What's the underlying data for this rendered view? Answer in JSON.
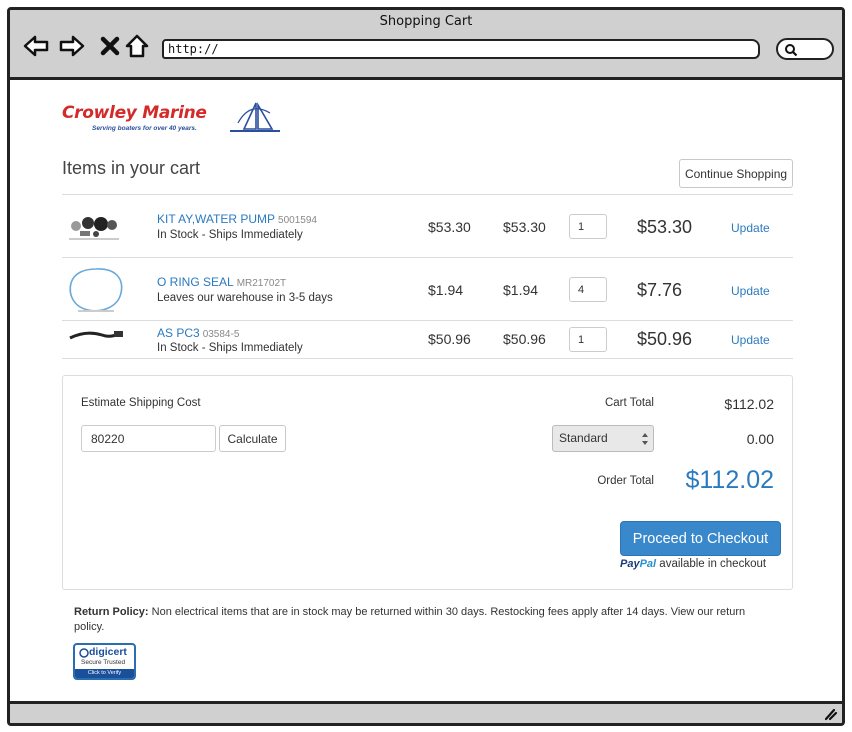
{
  "window": {
    "title": "Shopping Cart",
    "url": "http://"
  },
  "brand": {
    "name": "Crowley Marine",
    "tagline": "Serving boaters for over 40 years.",
    "color": "#d42a2a"
  },
  "page": {
    "title": "Items in your cart",
    "continue_label": "Continue Shopping"
  },
  "cart": {
    "items": [
      {
        "name": "KIT AY,WATER PUMP",
        "sku": "5001594",
        "status": "In Stock - Ships Immediately",
        "price": "$53.30",
        "sale_price": "$53.30",
        "qty": "1",
        "total": "$53.30",
        "update_label": "Update"
      },
      {
        "name": "O RING SEAL",
        "sku": "MR21702T",
        "status": "Leaves our warehouse in 3-5 days",
        "price": "$1.94",
        "sale_price": "$1.94",
        "qty": "4",
        "total": "$7.76",
        "update_label": "Update"
      },
      {
        "name": "AS PC3",
        "sku": "03584-5",
        "status": "In Stock - Ships Immediately",
        "price": "$50.96",
        "sale_price": "$50.96",
        "qty": "1",
        "total": "$50.96",
        "update_label": "Update"
      }
    ]
  },
  "shipping": {
    "label": "Estimate Shipping Cost",
    "zip": "80220",
    "calculate_label": "Calculate",
    "method": "Standard",
    "cost": "0.00"
  },
  "summary": {
    "cart_total_label": "Cart Total",
    "cart_total": "$112.02",
    "order_total_label": "Order Total",
    "order_total": "$112.02",
    "checkout_label": "Proceed to Checkout",
    "paypal_pay": "Pay",
    "paypal_pal": "Pal",
    "paypal_note": "available in checkout",
    "accent": "#3a88cc"
  },
  "policy": {
    "heading": "Return Policy:",
    "text": "Non electrical items that are in stock may be returned within 30 days. Restocking fees apply after 14 days. View our return policy."
  },
  "badge": {
    "name": "digicert",
    "sub": "Secure Trusted",
    "strip": "Click to Verify"
  }
}
